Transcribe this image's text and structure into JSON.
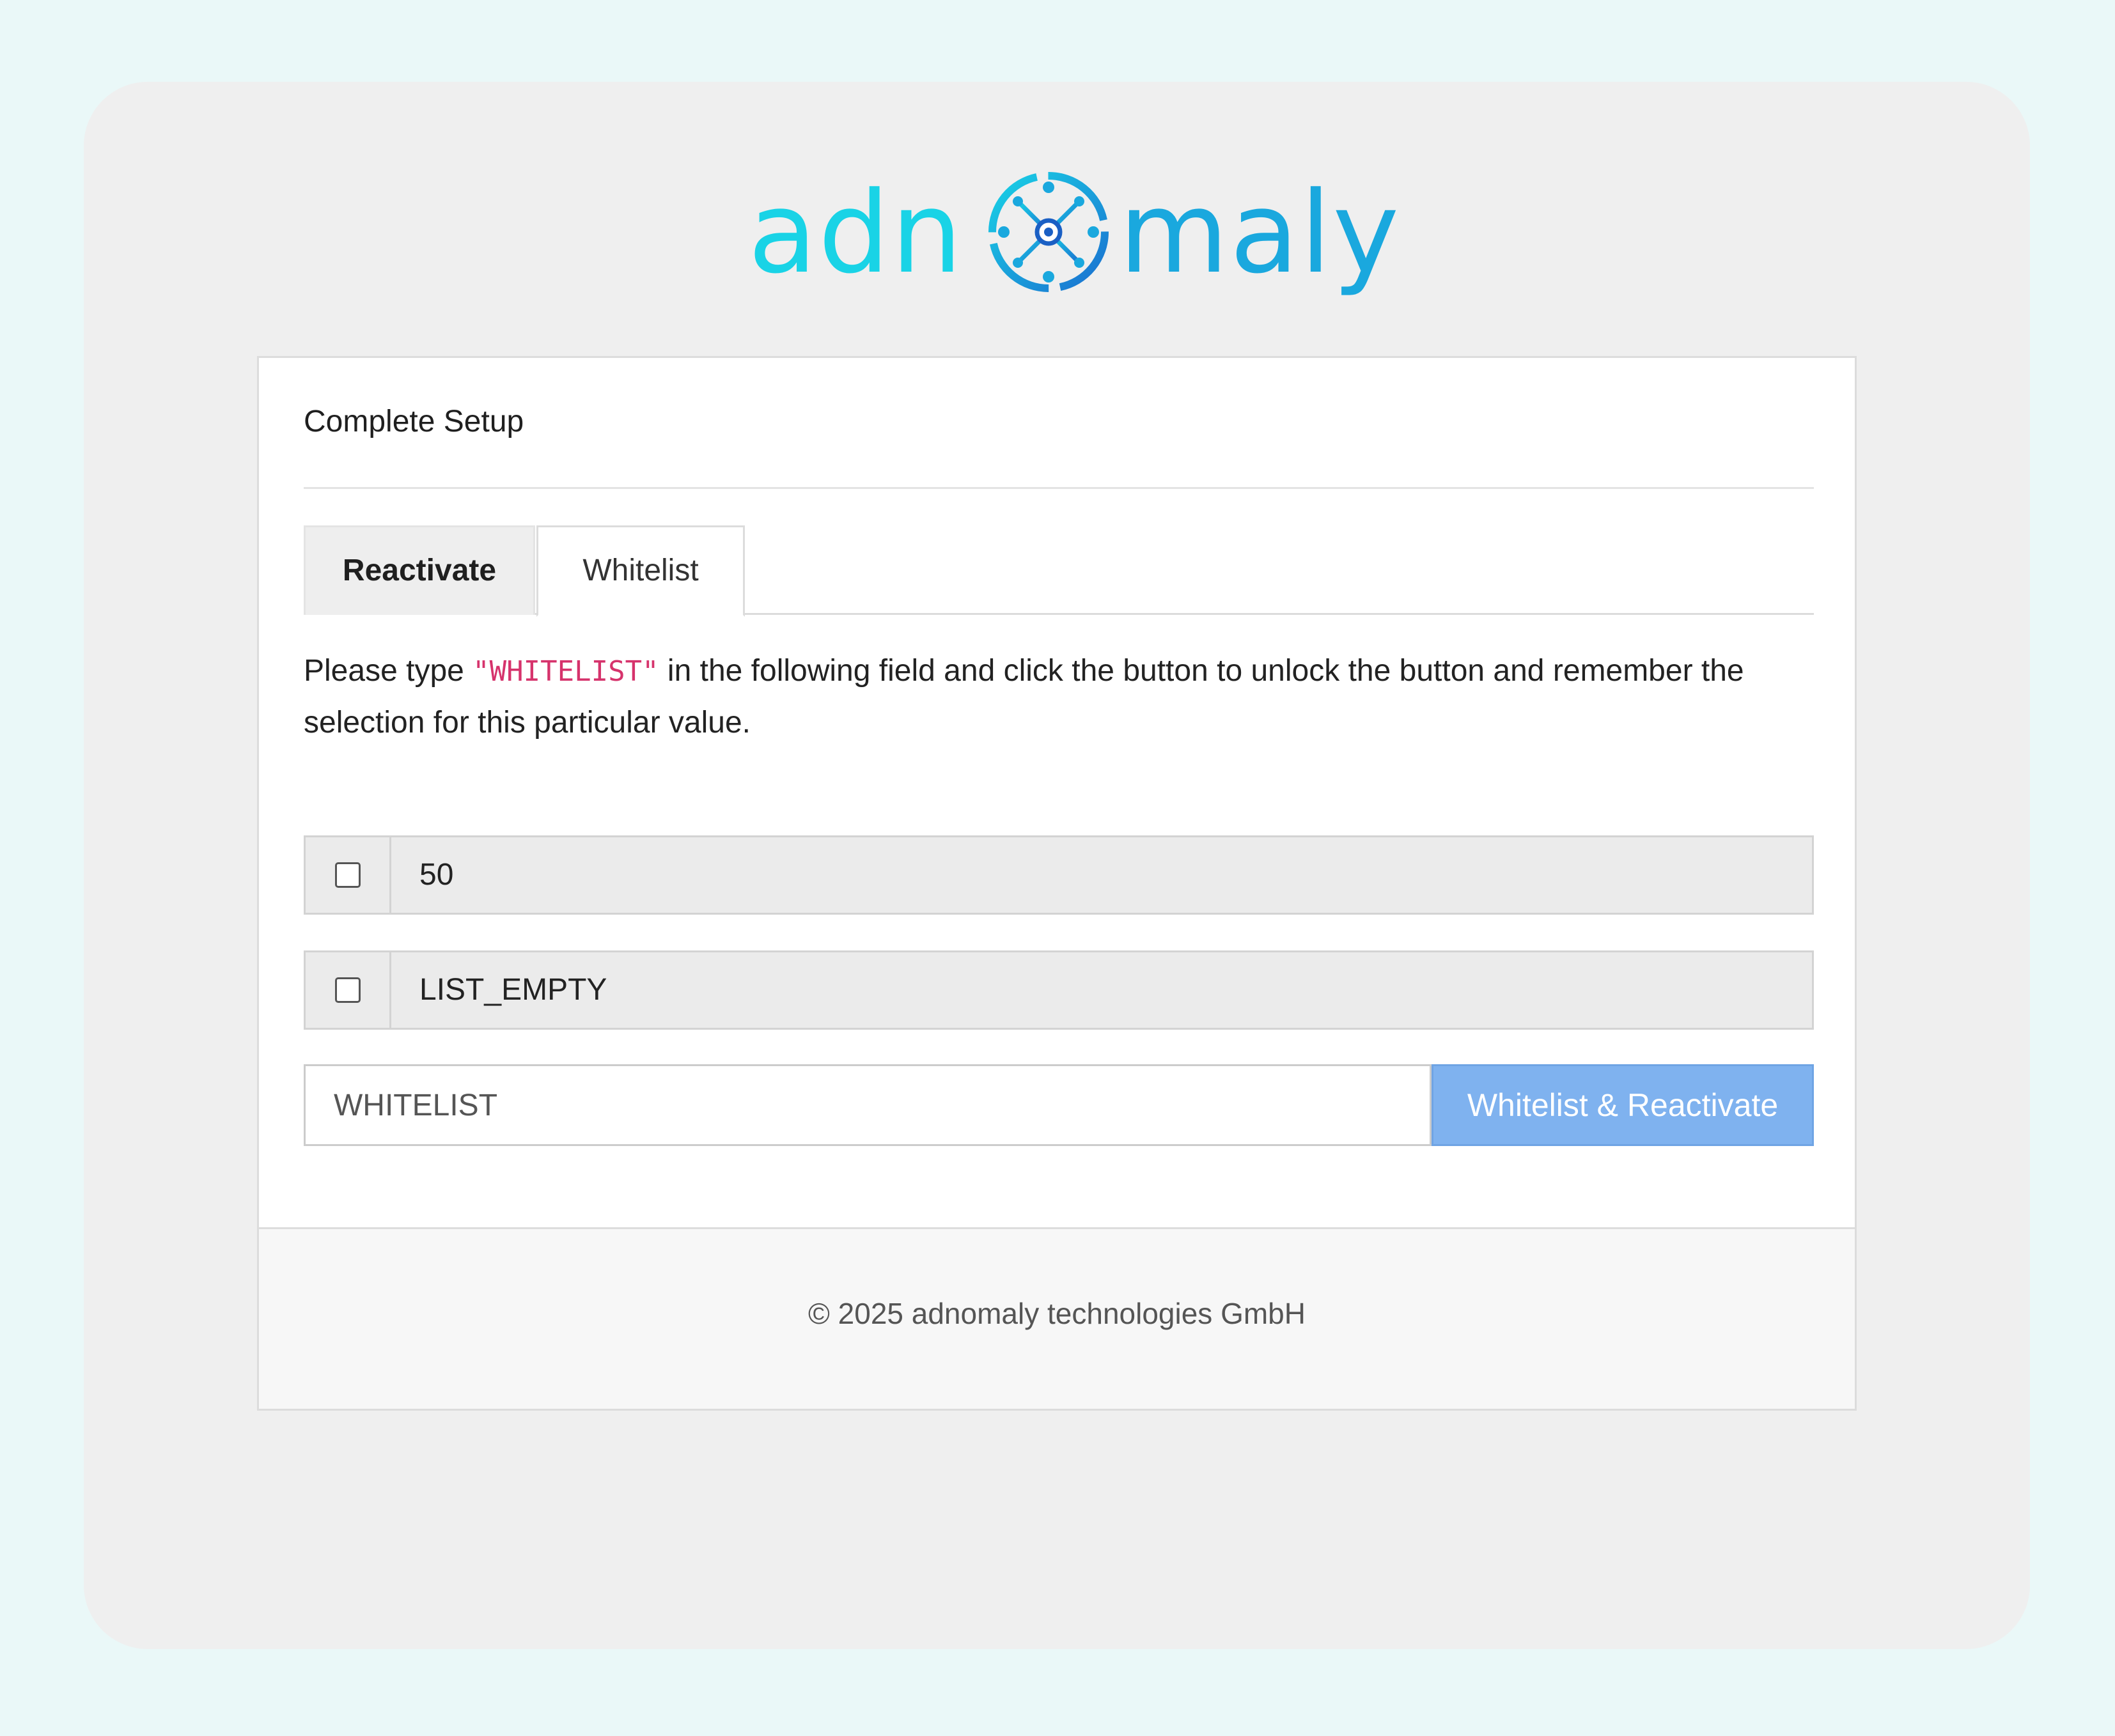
{
  "brand": {
    "logo_left": "adn",
    "logo_right": "maly",
    "logo_color_left": "#19d3e6",
    "logo_color_right": "#1aa8de"
  },
  "card": {
    "title": "Complete Setup",
    "tabs": [
      {
        "label": "Reactivate",
        "active": false
      },
      {
        "label": "Whitelist",
        "active": true
      }
    ],
    "instructions": {
      "before": "Please type ",
      "keyword": "\"WHITELIST\"",
      "after": " in the following field and click the button to unlock the button and remember the selection for this particular value."
    },
    "options": [
      {
        "label": "50",
        "checked": false
      },
      {
        "label": "LIST_EMPTY",
        "checked": false
      }
    ],
    "input": {
      "value": "WHITELIST",
      "placeholder": ""
    },
    "submit_label": "Whitelist & Reactivate",
    "accent_color": "#7fb2ef"
  },
  "footer": {
    "text": "© 2025 adnomaly technologies GmbH"
  }
}
